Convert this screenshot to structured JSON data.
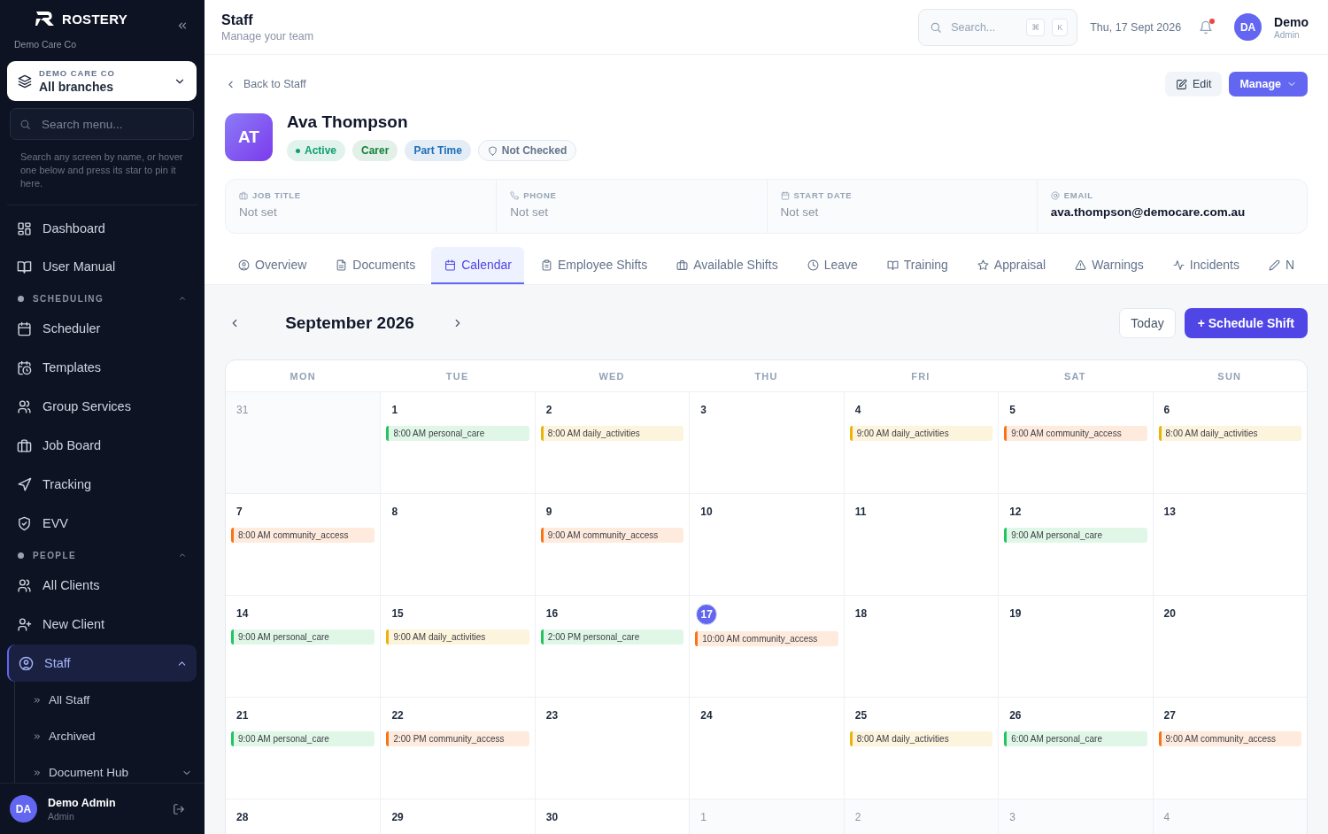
{
  "sidebar": {
    "brand": "ROSTERY",
    "company": "Demo Care Co",
    "branch": {
      "label": "DEMO CARE CO",
      "value": "All branches"
    },
    "search": {
      "placeholder": "Search menu..."
    },
    "hint": "Search any screen by name, or hover one below and press its star to pin it here.",
    "nav": [
      {
        "kind": "item",
        "label": "Dashboard",
        "selected": false
      },
      {
        "kind": "item",
        "label": "User Manual",
        "selected": false
      },
      {
        "kind": "section",
        "label": "SCHEDULING",
        "expanded": true
      },
      {
        "kind": "item",
        "label": "Scheduler",
        "selected": false
      },
      {
        "kind": "item",
        "label": "Templates",
        "selected": false
      },
      {
        "kind": "item",
        "label": "Group Services",
        "selected": false
      },
      {
        "kind": "item",
        "label": "Job Board",
        "selected": false
      },
      {
        "kind": "item",
        "label": "Tracking",
        "selected": false
      },
      {
        "kind": "item",
        "label": "EVV",
        "selected": false
      },
      {
        "kind": "section",
        "label": "PEOPLE",
        "expanded": true
      },
      {
        "kind": "item",
        "label": "All Clients",
        "selected": false
      },
      {
        "kind": "item",
        "label": "New Client",
        "selected": false
      },
      {
        "kind": "item",
        "label": "Staff",
        "selected": true,
        "expanded": true,
        "children": [
          {
            "label": "All Staff",
            "selected": false
          },
          {
            "label": "Archived",
            "selected": false
          },
          {
            "label": "Document Hub",
            "selected": false,
            "expanded": false
          }
        ]
      }
    ],
    "user": {
      "initials": "DA",
      "name": "Demo Admin",
      "role": "Admin"
    }
  },
  "header": {
    "title": "Staff",
    "subtitle": "Manage your team",
    "search": {
      "placeholder": "Search...",
      "keys": [
        "⌘",
        "K"
      ]
    },
    "date": "Thu, 17 Sept 2026",
    "notifications_unread": true,
    "user": {
      "initials": "DA",
      "name": "Demo",
      "role": "Admin"
    }
  },
  "profile": {
    "back": "Back to Staff",
    "actions": [
      "Edit",
      "Manage"
    ],
    "initials": "AT",
    "name": "Ava Thompson",
    "badges": [
      {
        "kind": "status",
        "label": "Active",
        "color": "#0f9f6e"
      },
      {
        "kind": "tag",
        "label": "Carer",
        "color": "#15803d"
      },
      {
        "kind": "tag",
        "label": "Part Time",
        "color": "#1d6fb8"
      },
      {
        "kind": "check",
        "label": "Not Checked",
        "color": "#64748b"
      }
    ],
    "fields": [
      {
        "label": "JOB TITLE",
        "value": "Not set",
        "empty": true
      },
      {
        "label": "PHONE",
        "value": "Not set",
        "empty": true
      },
      {
        "label": "START DATE",
        "value": "Not set",
        "empty": true
      },
      {
        "label": "EMAIL",
        "value": "ava.thompson@democare.com.au",
        "empty": false
      }
    ]
  },
  "tabs": [
    {
      "label": "Overview",
      "selected": false
    },
    {
      "label": "Documents",
      "selected": false
    },
    {
      "label": "Calendar",
      "selected": true
    },
    {
      "label": "Employee Shifts",
      "selected": false
    },
    {
      "label": "Available Shifts",
      "selected": false
    },
    {
      "label": "Leave",
      "selected": false
    },
    {
      "label": "Training",
      "selected": false
    },
    {
      "label": "Appraisal",
      "selected": false
    },
    {
      "label": "Warnings",
      "selected": false
    },
    {
      "label": "Incidents",
      "selected": false
    },
    {
      "label": "N",
      "selected": false
    }
  ],
  "calendar": {
    "month": "September 2026",
    "today_button": "Today",
    "schedule_button": "+ Schedule Shift",
    "weekdays": [
      "MON",
      "TUE",
      "WED",
      "THU",
      "FRI",
      "SAT",
      "SUN"
    ],
    "days": [
      {
        "day": "31",
        "other_month": true,
        "today": false
      },
      {
        "day": "1",
        "other_month": false,
        "today": false,
        "events": [
          {
            "text": "8:00 AM personal_care",
            "color": "#22c55e"
          }
        ]
      },
      {
        "day": "2",
        "other_month": false,
        "today": false,
        "events": [
          {
            "text": "8:00 AM daily_activities",
            "color": "#eab308"
          }
        ]
      },
      {
        "day": "3",
        "other_month": false,
        "today": false
      },
      {
        "day": "4",
        "other_month": false,
        "today": false,
        "events": [
          {
            "text": "9:00 AM daily_activities",
            "color": "#eab308"
          }
        ]
      },
      {
        "day": "5",
        "other_month": false,
        "today": false,
        "events": [
          {
            "text": "9:00 AM community_access",
            "color": "#f97316"
          }
        ]
      },
      {
        "day": "6",
        "other_month": false,
        "today": false,
        "events": [
          {
            "text": "8:00 AM daily_activities",
            "color": "#eab308"
          }
        ]
      },
      {
        "day": "7",
        "other_month": false,
        "today": false,
        "events": [
          {
            "text": "8:00 AM community_access",
            "color": "#f97316"
          }
        ]
      },
      {
        "day": "8",
        "other_month": false,
        "today": false
      },
      {
        "day": "9",
        "other_month": false,
        "today": false,
        "events": [
          {
            "text": "9:00 AM community_access",
            "color": "#f97316"
          }
        ]
      },
      {
        "day": "10",
        "other_month": false,
        "today": false
      },
      {
        "day": "11",
        "other_month": false,
        "today": false
      },
      {
        "day": "12",
        "other_month": false,
        "today": false,
        "events": [
          {
            "text": "9:00 AM personal_care",
            "color": "#22c55e"
          }
        ]
      },
      {
        "day": "13",
        "other_month": false,
        "today": false
      },
      {
        "day": "14",
        "other_month": false,
        "today": false,
        "events": [
          {
            "text": "9:00 AM personal_care",
            "color": "#22c55e"
          }
        ]
      },
      {
        "day": "15",
        "other_month": false,
        "today": false,
        "events": [
          {
            "text": "9:00 AM daily_activities",
            "color": "#eab308"
          }
        ]
      },
      {
        "day": "16",
        "other_month": false,
        "today": false,
        "events": [
          {
            "text": "2:00 PM personal_care",
            "color": "#22c55e"
          }
        ]
      },
      {
        "day": "17",
        "other_month": false,
        "today": true,
        "events": [
          {
            "text": "10:00 AM community_access",
            "color": "#f97316"
          }
        ]
      },
      {
        "day": "18",
        "other_month": false,
        "today": false
      },
      {
        "day": "19",
        "other_month": false,
        "today": false
      },
      {
        "day": "20",
        "other_month": false,
        "today": false
      },
      {
        "day": "21",
        "other_month": false,
        "today": false,
        "events": [
          {
            "text": "9:00 AM personal_care",
            "color": "#22c55e"
          }
        ]
      },
      {
        "day": "22",
        "other_month": false,
        "today": false,
        "events": [
          {
            "text": "2:00 PM community_access",
            "color": "#f97316"
          }
        ]
      },
      {
        "day": "23",
        "other_month": false,
        "today": false
      },
      {
        "day": "24",
        "other_month": false,
        "today": false
      },
      {
        "day": "25",
        "other_month": false,
        "today": false,
        "events": [
          {
            "text": "8:00 AM daily_activities",
            "color": "#eab308"
          }
        ]
      },
      {
        "day": "26",
        "other_month": false,
        "today": false,
        "events": [
          {
            "text": "6:00 AM personal_care",
            "color": "#22c55e"
          }
        ]
      },
      {
        "day": "27",
        "other_month": false,
        "today": false,
        "events": [
          {
            "text": "9:00 AM community_access",
            "color": "#f97316"
          }
        ]
      },
      {
        "day": "28",
        "other_month": false,
        "today": false
      },
      {
        "day": "29",
        "other_month": false,
        "today": false
      },
      {
        "day": "30",
        "other_month": false,
        "today": false
      },
      {
        "day": "1",
        "other_month": true,
        "today": false
      },
      {
        "day": "2",
        "other_month": true,
        "today": false
      },
      {
        "day": "3",
        "other_month": true,
        "today": false
      },
      {
        "day": "4",
        "other_month": true,
        "today": false
      }
    ]
  }
}
